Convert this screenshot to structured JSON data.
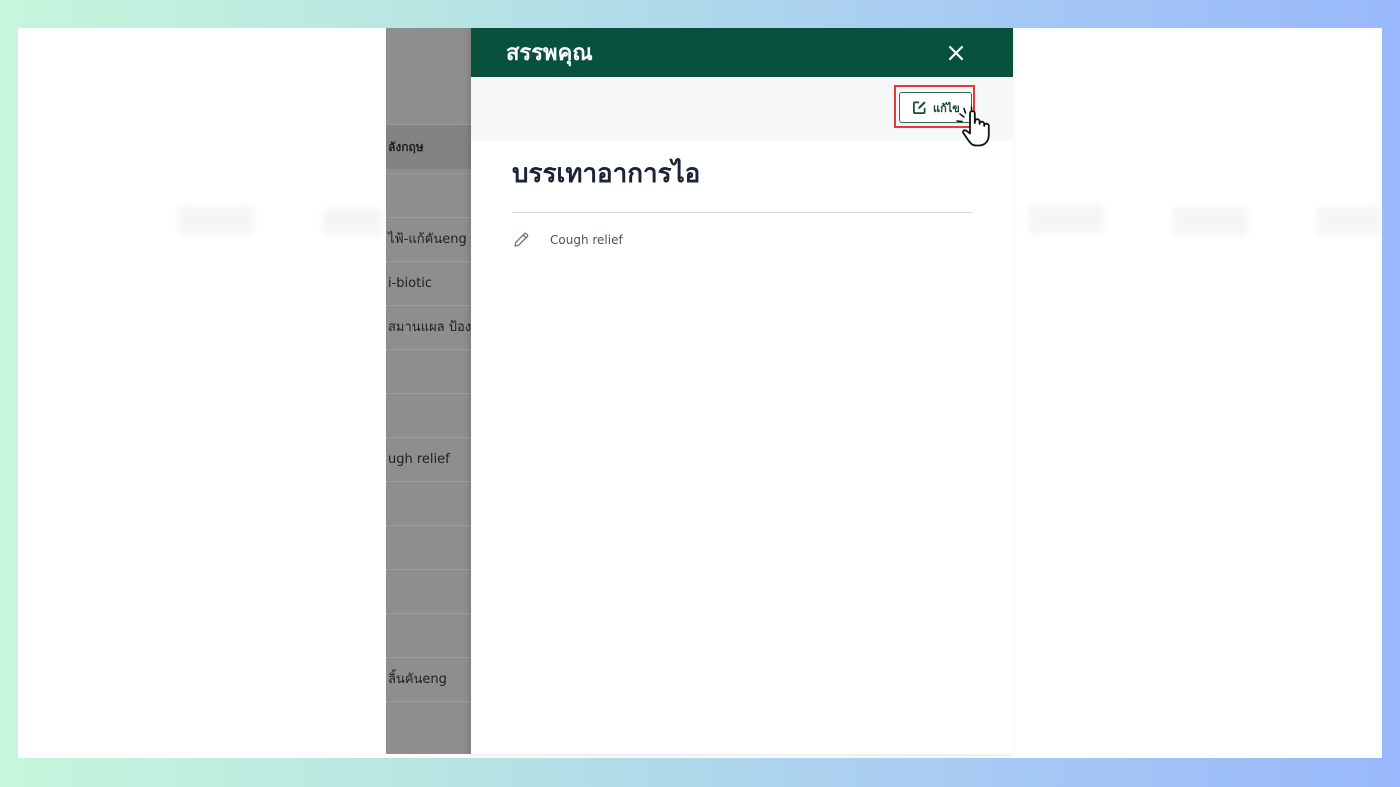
{
  "underlying_list": {
    "header": "ลังกฤษ",
    "rows": [
      "",
      "ไฟ้-แก้คันeng",
      "i-biotic",
      "สมานแผล ป้องกั",
      "",
      "",
      "ugh relief",
      "",
      "",
      "",
      "",
      "ลิ้นคันeng",
      ""
    ]
  },
  "drawer": {
    "title": "สรรพคุณ",
    "close_label": "×",
    "toolbar": {
      "edit_label": "แก้ไข"
    },
    "content": {
      "heading": "บรรเทาอาการไอ",
      "detail_text": "Cough relief"
    }
  },
  "colors": {
    "header_bg": "#07513d",
    "highlight": "#e53935",
    "edit_border": "#2f6b55"
  },
  "icons": [
    "close-icon",
    "edit-icon",
    "pencil-icon",
    "pointer-hand-icon"
  ]
}
